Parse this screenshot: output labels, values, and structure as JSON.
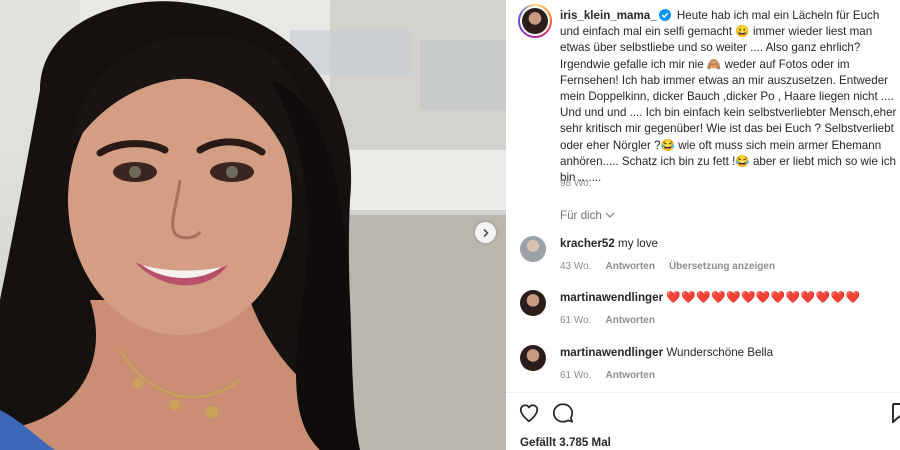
{
  "post": {
    "username": "iris_klein_mama_",
    "caption": "Heute hab ich mal ein Lächeln für Euch und einfach mal ein selfi gemacht 😀 immer wieder liest man etwas über selbstliebe und so weiter .... Also ganz ehrlich? Irgendwie gefalle ich mir nie 🙈 weder auf Fotos oder im Fernsehen! Ich hab immer etwas an mir auszusetzen. Entweder mein Doppelkinn, dicker Bauch ,dicker Po , Haare liegen nicht .... Und und und .... Ich bin einfach kein selbstverliebter Mensch,eher sehr kritisch mir gegenüber! Wie ist das bei Euch ? Selbstverliebt oder eher Nörgler ?😂 wie oft muss sich mein armer Ehemann anhören..... Schatz ich bin zu fett !😂 aber er liebt mich so wie ich bin .......",
    "time": "98 Wo.",
    "translate_label": "Für dich",
    "likes": "Gefällt 3.785 Mal"
  },
  "comments": [
    {
      "username": "kracher52",
      "text": "my love",
      "time": "43 Wo.",
      "reply": "Antworten",
      "translate": "Übersetzung anzeigen"
    },
    {
      "username": "martinawendlinger",
      "text": "❤️❤️❤️❤️❤️❤️❤️❤️❤️❤️❤️❤️❤️",
      "time": "61 Wo.",
      "reply": "Antworten"
    },
    {
      "username": "martinawendlinger",
      "text": "Wunderschöne Bella",
      "time": "61 Wo.",
      "reply": "Antworten"
    }
  ],
  "icons": [
    "chevron-right-icon",
    "verified-badge-icon",
    "chevron-down-icon",
    "heart-icon",
    "comment-icon",
    "bookmark-icon"
  ],
  "colors": {
    "verified": "#0095f6",
    "heart": "#ed1c24",
    "secondary_text": "#8e8e8e"
  }
}
